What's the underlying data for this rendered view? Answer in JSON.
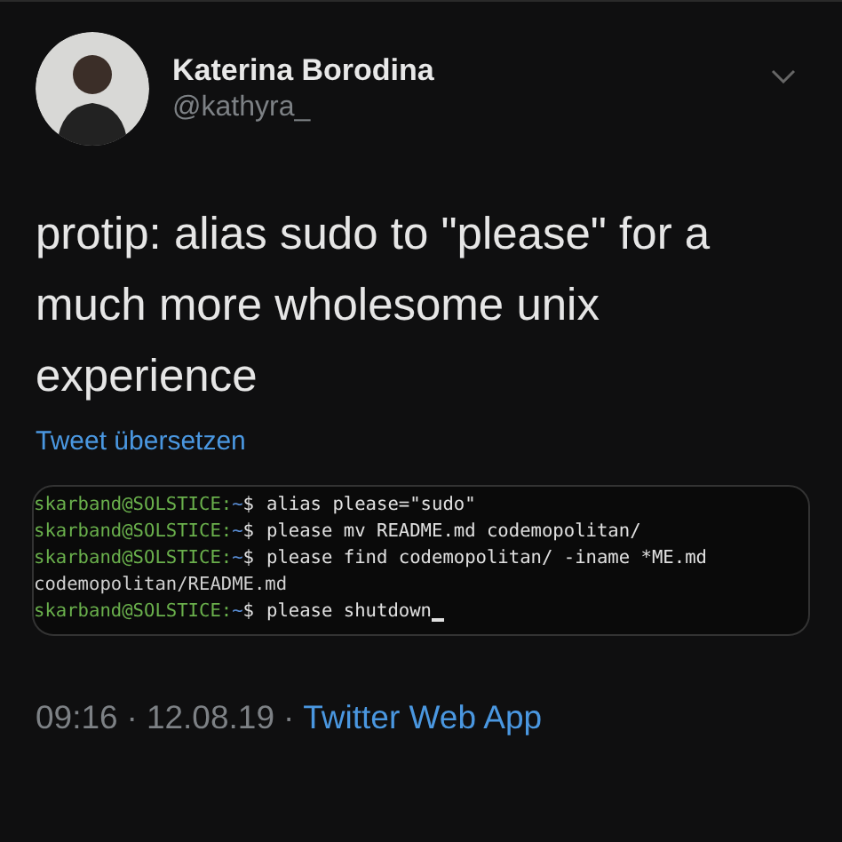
{
  "author": {
    "name": "Katerina Borodina",
    "handle": "@kathyra_"
  },
  "tweet": {
    "text": "protip: alias sudo to \"please\" for a much more wholesome unix experience",
    "translate_link": "Tweet übersetzen"
  },
  "terminal": {
    "lines": [
      {
        "kind": "prompt",
        "user": "skarband@SOLSTICE",
        "sep": ":",
        "path": "~",
        "symbol": "$",
        "command": "alias please=\"sudo\""
      },
      {
        "kind": "prompt",
        "user": "skarband@SOLSTICE",
        "sep": ":",
        "path": "~",
        "symbol": "$",
        "command": "please mv README.md codemopolitan/"
      },
      {
        "kind": "prompt",
        "user": "skarband@SOLSTICE",
        "sep": ":",
        "path": "~",
        "symbol": "$",
        "command": "please find codemopolitan/ -iname *ME.md"
      },
      {
        "kind": "output",
        "text": "codemopolitan/README.md"
      },
      {
        "kind": "prompt",
        "user": "skarband@SOLSTICE",
        "sep": ":",
        "path": "~",
        "symbol": "$",
        "command": "please shutdown",
        "cursor": true
      }
    ]
  },
  "footer": {
    "time": "09:16",
    "separator_1": "·",
    "date": "12.08.19",
    "separator_2": "·",
    "source": "Twitter Web App"
  }
}
